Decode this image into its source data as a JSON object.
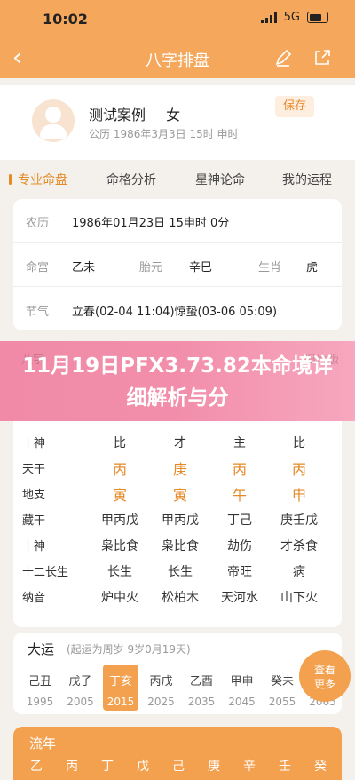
{
  "status_bar": {
    "time": "10:02",
    "network": "5G"
  },
  "nav": {
    "back": "‹",
    "title": "八字排盘"
  },
  "profile": {
    "name": "测试案例",
    "gender": "女",
    "date": "公历 1986年3月3日 15时 申时",
    "save_label": "保存"
  },
  "tabs": [
    "专业命盘",
    "命格分析",
    "星神论命",
    "我的运程"
  ],
  "info": {
    "lunar_label": "农历",
    "lunar_value": "1986年01月23日 15申时 0分",
    "minggong_label": "命宫",
    "minggong_value": "乙未",
    "taiyuan_label": "胎元",
    "taiyuan_value": "辛巳",
    "shengxiao_label": "生肖",
    "shengxiao_value": "虎",
    "jieqi_label": "节气",
    "jieqi_value": "立春(02-04 11:04)惊蛰(03-06 05:09)"
  },
  "banner": {
    "title": "11月19日PFX3.73.82本命境详细解析与分",
    "behind_left": "八字",
    "behind_right": "旧片版"
  },
  "bazi_table": {
    "rows": [
      {
        "label": "十神",
        "cells": [
          "比",
          "才",
          "主",
          "比"
        ]
      },
      {
        "label": "天干",
        "cells": [
          "丙",
          "庚",
          "丙",
          "丙"
        ],
        "highlight": true
      },
      {
        "label": "地支",
        "cells": [
          "寅",
          "寅",
          "午",
          "申"
        ],
        "highlight": true
      },
      {
        "label": "藏干",
        "cells": [
          "甲丙戊",
          "甲丙戊",
          "丁己",
          "庚壬戊"
        ]
      },
      {
        "label": "十神",
        "cells": [
          "枭比食",
          "枭比食",
          "劫伤",
          "才杀食"
        ]
      },
      {
        "label": "十二长生",
        "cells": [
          "长生",
          "长生",
          "帝旺",
          "病"
        ]
      },
      {
        "label": "纳音",
        "cells": [
          "炉中火",
          "松柏木",
          "天河水",
          "山下火"
        ]
      }
    ]
  },
  "dayun": {
    "title": "大运",
    "subtitle": "(起运为周岁 9岁0月19天)",
    "items": [
      {
        "gz": "己丑",
        "year": "1995"
      },
      {
        "gz": "戊子",
        "year": "2005"
      },
      {
        "gz": "丁亥",
        "year": "2015",
        "active": true
      },
      {
        "gz": "丙戌",
        "year": "2025"
      },
      {
        "gz": "乙酉",
        "year": "2035"
      },
      {
        "gz": "甲申",
        "year": "2045"
      },
      {
        "gz": "癸未",
        "year": "2055"
      },
      {
        "gz": "壬",
        "year": "2065"
      }
    ],
    "more_line1": "查看",
    "more_line2": "更多"
  },
  "liunian": {
    "title": "流年",
    "items": [
      "乙",
      "丙",
      "丁",
      "戊",
      "己",
      "庚",
      "辛",
      "壬",
      "癸"
    ]
  },
  "colors": {
    "accent": "#f3a14f",
    "highlight": "#e48a27",
    "banner": "#f08aa7"
  }
}
